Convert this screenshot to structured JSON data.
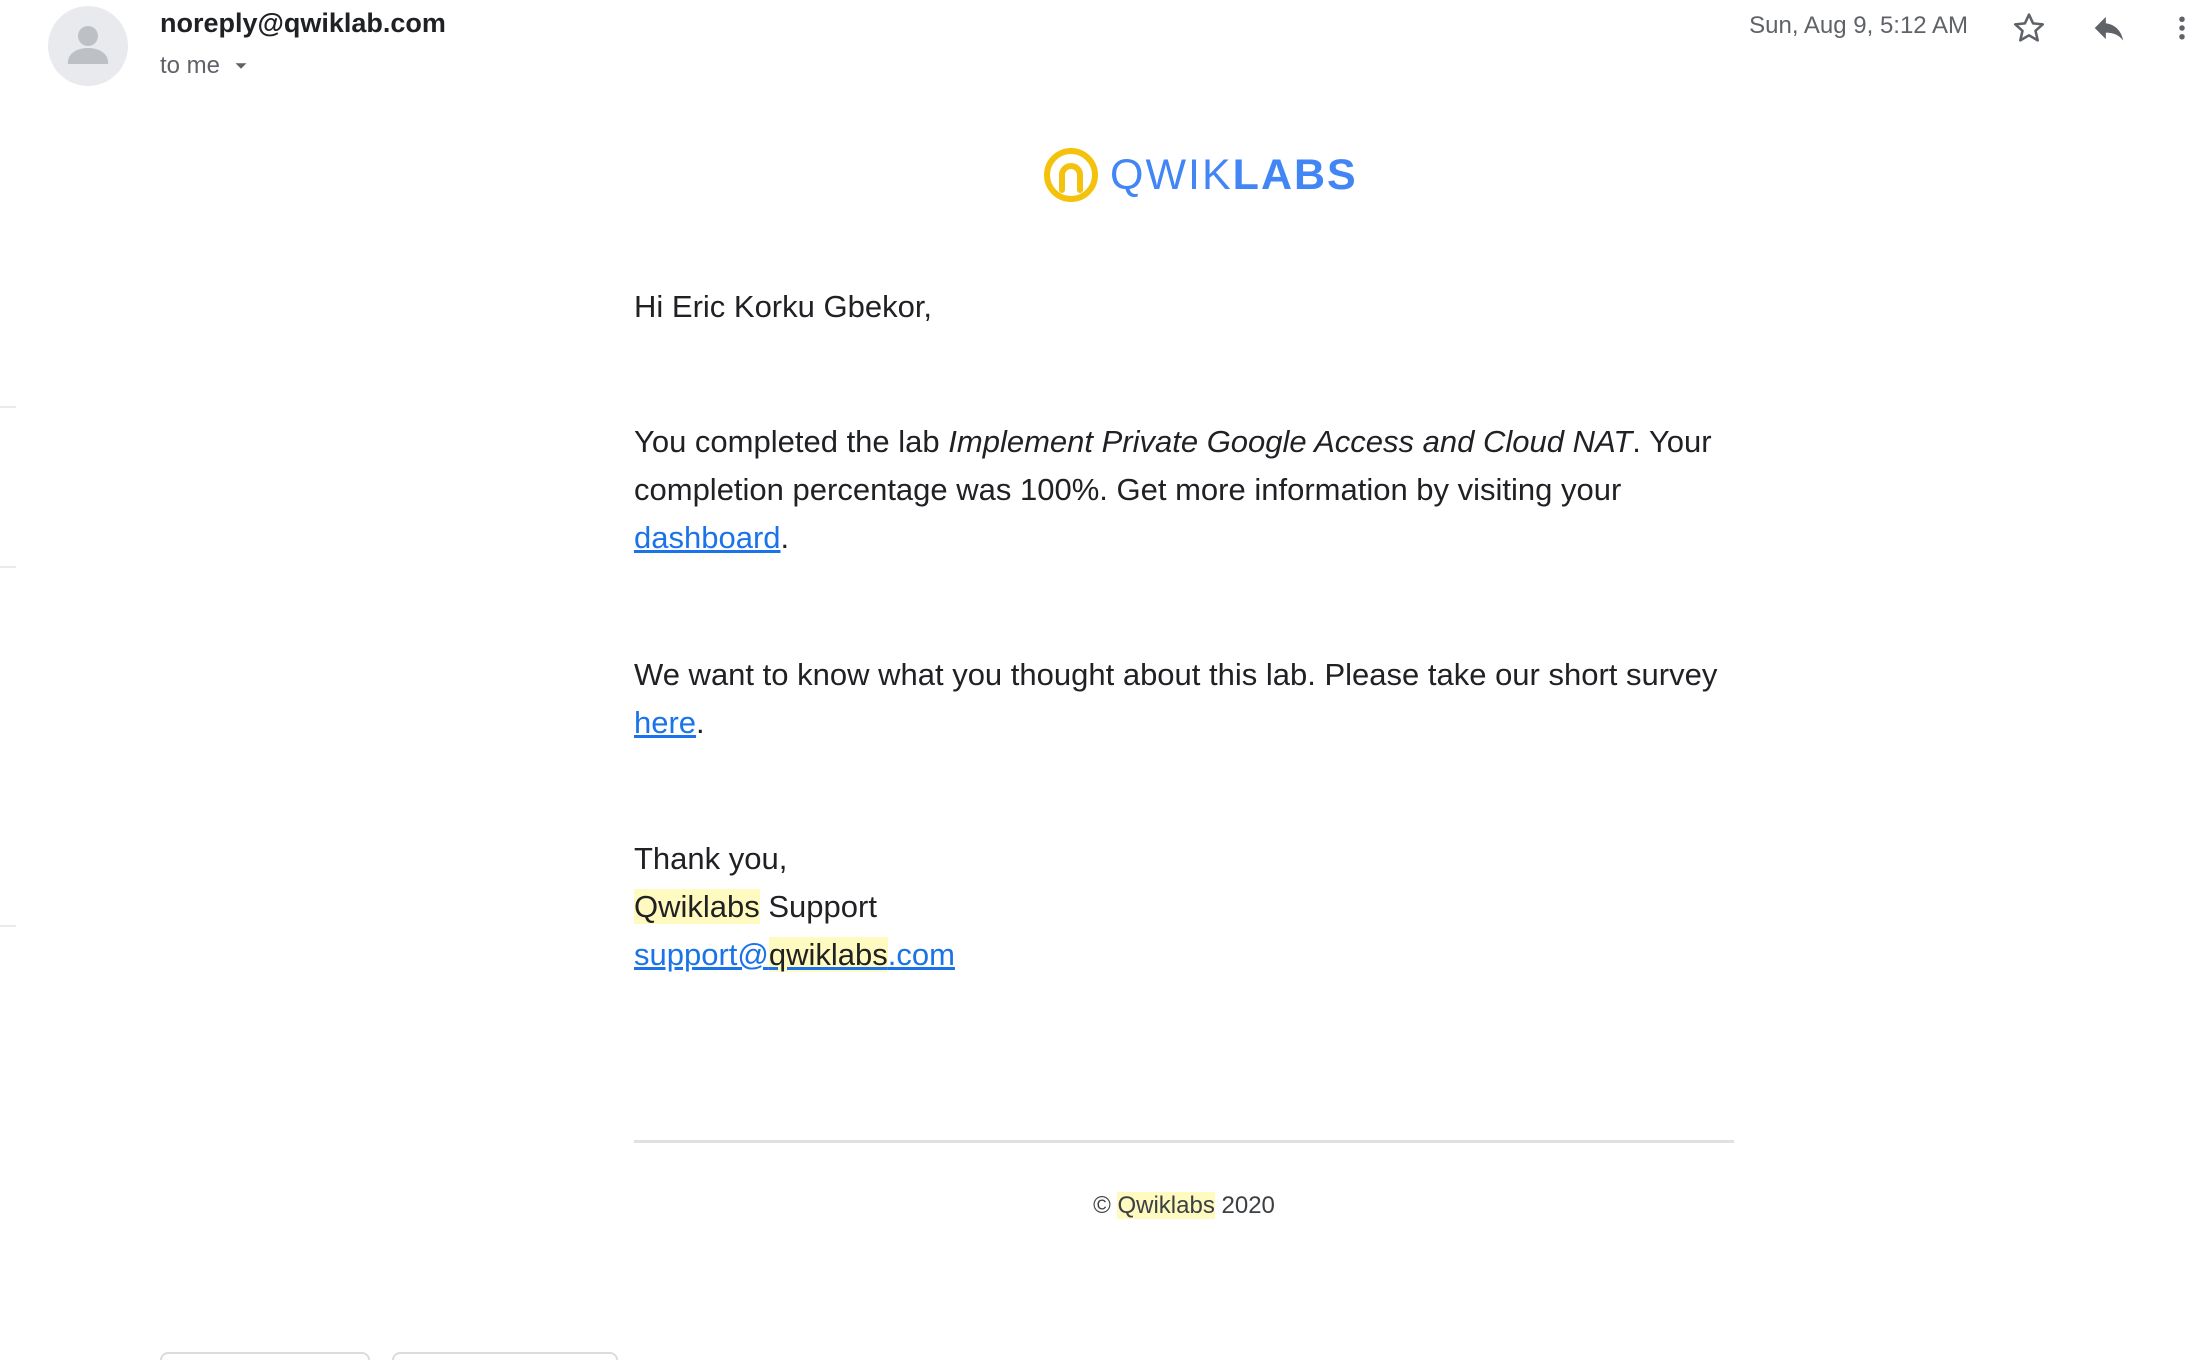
{
  "header": {
    "sender": "noreply@qwiklab.com",
    "recipient_label": "to me",
    "timestamp": "Sun, Aug 9, 5:12 AM",
    "icons": {
      "avatar": "person-icon",
      "recipient_toggle": "chevron-down-icon",
      "star": "star-icon",
      "reply": "reply-icon",
      "more": "more-vert-icon"
    }
  },
  "logo": {
    "word_light": "QWIK",
    "word_bold": "LABS",
    "icon": "qwiklabs-logo-icon",
    "colors": {
      "mark": "#f4c20d",
      "text": "#4285f4"
    }
  },
  "email": {
    "greeting": "Hi Eric Korku Gbekor,",
    "para1_pre": "You completed the lab ",
    "lab_name": "Implement Private Google Access and Cloud NAT",
    "para1_mid": ". Your completion percentage was 100%. Get more information by visiting your ",
    "dashboard_link": "dashboard",
    "para1_end": ".",
    "para2_pre": "We want to know what you thought about this lab. Please take our short survey ",
    "survey_link": "here",
    "para2_end": ".",
    "thanks": "Thank you,",
    "sig_brand": "Qwiklabs",
    "sig_rest": " Support",
    "email_link_pre": "support@",
    "email_link_brand": "qwiklabs",
    "email_link_post": ".com"
  },
  "footer": {
    "copyright_symbol": "©",
    "brand": "Qwiklabs",
    "year": "2020"
  },
  "colors": {
    "link": "#1a73e8",
    "highlight": "#fffabf",
    "secondary_text": "#5f6368"
  }
}
